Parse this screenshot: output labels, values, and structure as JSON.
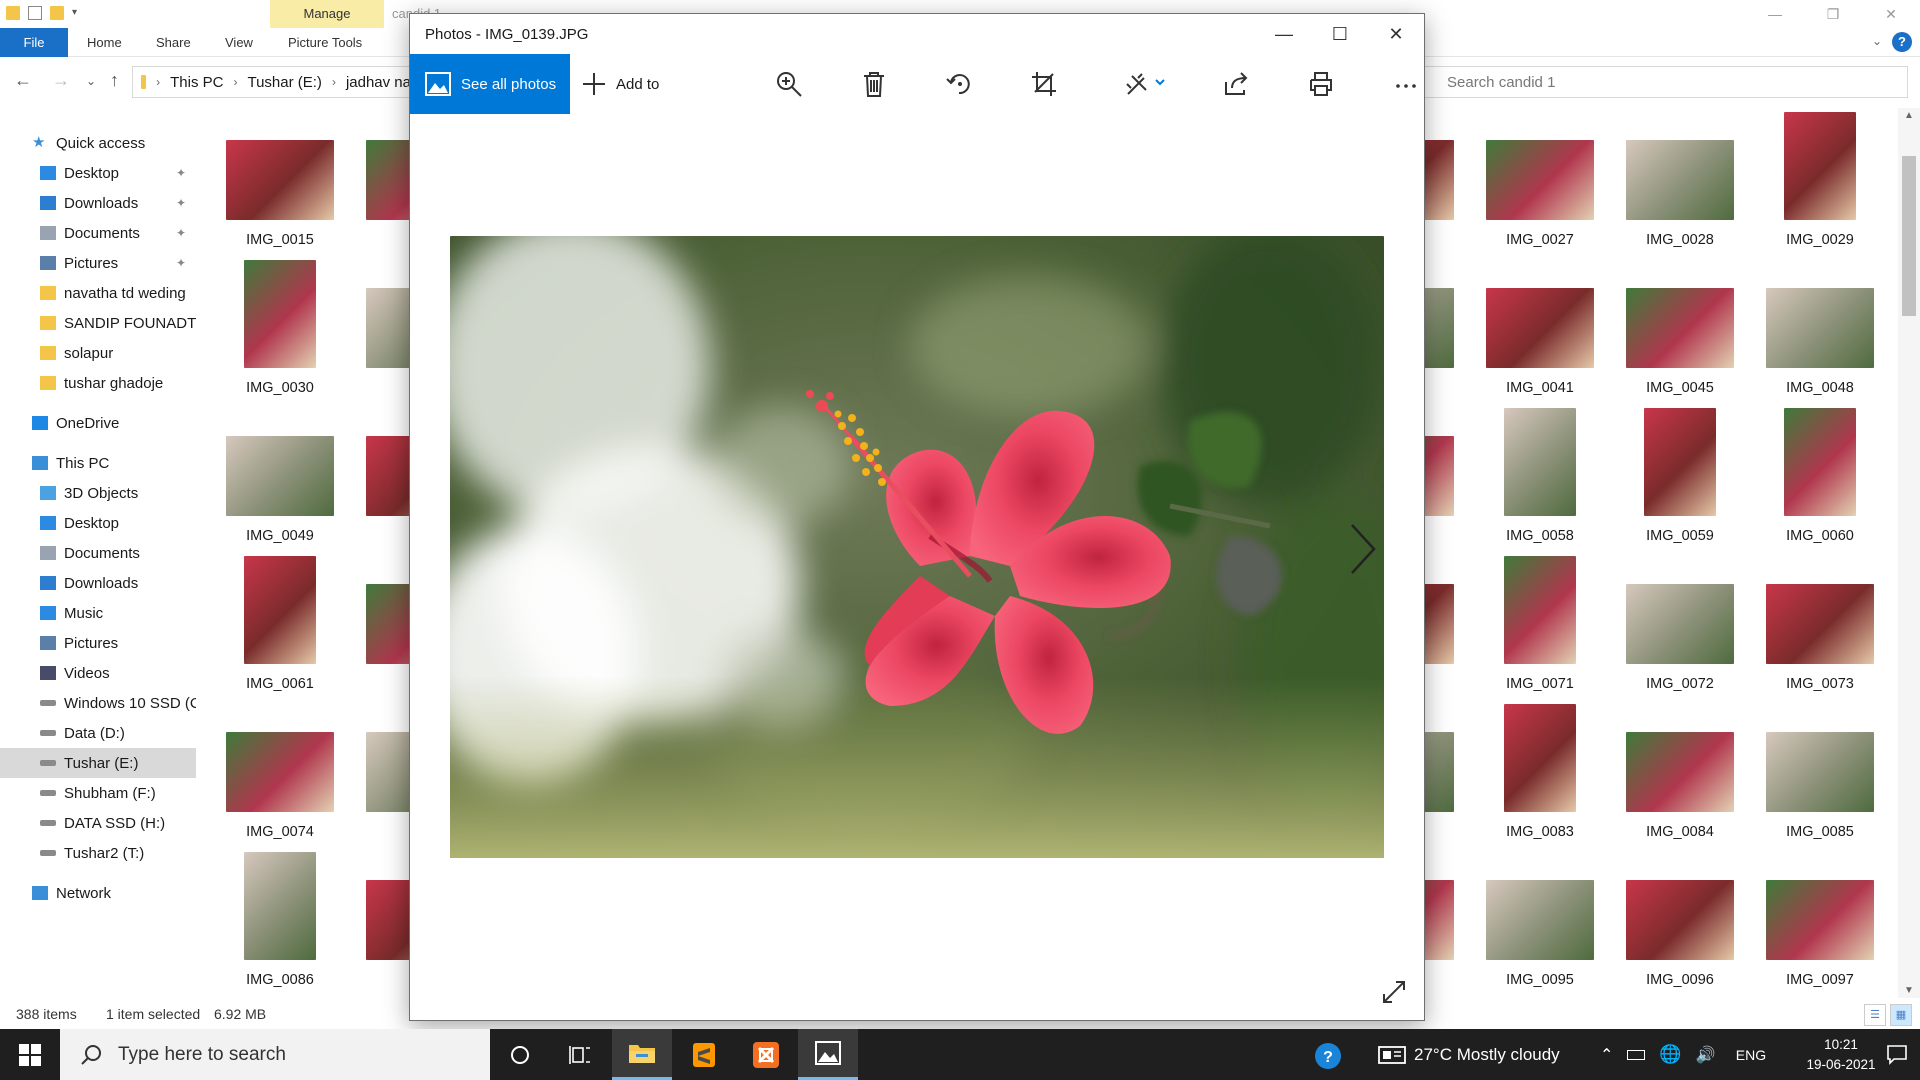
{
  "explorer": {
    "title": "candid 1",
    "ribbon": {
      "manage_label": "Manage",
      "tabs": [
        "File",
        "Home",
        "Share",
        "View",
        "Picture Tools"
      ]
    },
    "address": {
      "crumbs": [
        "This PC",
        "Tushar (E:)",
        "jadhav na"
      ]
    },
    "search_placeholder": "Search candid 1",
    "navpane": [
      {
        "label": "Quick access",
        "icon": "star-icon",
        "indent": 1
      },
      {
        "label": "Desktop",
        "icon": "desktop-icon",
        "indent": 2,
        "pinned": true
      },
      {
        "label": "Downloads",
        "icon": "download-icon",
        "indent": 2,
        "pinned": true
      },
      {
        "label": "Documents",
        "icon": "document-icon",
        "indent": 2,
        "pinned": true
      },
      {
        "label": "Pictures",
        "icon": "pictures-icon",
        "indent": 2,
        "pinned": true
      },
      {
        "label": "navatha td weding",
        "icon": "folder-icon",
        "indent": 2
      },
      {
        "label": "SANDIP FOUNADTI(",
        "icon": "folder-icon",
        "indent": 2
      },
      {
        "label": "solapur",
        "icon": "folder-icon",
        "indent": 2
      },
      {
        "label": "tushar ghadoje",
        "icon": "folder-icon",
        "indent": 2
      },
      {
        "label": "OneDrive",
        "icon": "cloud-icon",
        "indent": 1
      },
      {
        "label": "This PC",
        "icon": "pc-icon",
        "indent": 1
      },
      {
        "label": "3D Objects",
        "icon": "cube-icon",
        "indent": 2
      },
      {
        "label": "Desktop",
        "icon": "desktop-icon",
        "indent": 2
      },
      {
        "label": "Documents",
        "icon": "document-icon",
        "indent": 2
      },
      {
        "label": "Downloads",
        "icon": "download-icon",
        "indent": 2
      },
      {
        "label": "Music",
        "icon": "music-icon",
        "indent": 2
      },
      {
        "label": "Pictures",
        "icon": "pictures-icon",
        "indent": 2
      },
      {
        "label": "Videos",
        "icon": "video-icon",
        "indent": 2
      },
      {
        "label": "Windows 10 SSD (C",
        "icon": "drive-icon",
        "indent": 2
      },
      {
        "label": "Data (D:)",
        "icon": "drive-icon",
        "indent": 2
      },
      {
        "label": "Tushar (E:)",
        "icon": "drive-icon",
        "indent": 2,
        "selected": true
      },
      {
        "label": "Shubham (F:)",
        "icon": "drive-icon",
        "indent": 2
      },
      {
        "label": "DATA SSD (H:)",
        "icon": "drive-icon",
        "indent": 2
      },
      {
        "label": "Tushar2 (T:)",
        "icon": "drive-icon",
        "indent": 2
      },
      {
        "label": "Network",
        "icon": "network-icon",
        "indent": 1
      }
    ],
    "files_left": [
      [
        "IMG_0015",
        "IM"
      ],
      [
        "IMG_0030",
        "IM"
      ],
      [
        "IMG_0049",
        "IM"
      ],
      [
        "IMG_0061",
        "IM"
      ],
      [
        "IMG_0074",
        "IM"
      ],
      [
        "IMG_0086",
        "IM"
      ]
    ],
    "files_right": [
      [
        "26",
        "IMG_0027",
        "IMG_0028",
        "IMG_0029"
      ],
      [
        "39",
        "IMG_0041",
        "IMG_0045",
        "IMG_0048"
      ],
      [
        "57",
        "IMG_0058",
        "IMG_0059",
        "IMG_0060"
      ],
      [
        "70",
        "IMG_0071",
        "IMG_0072",
        "IMG_0073"
      ],
      [
        "82",
        "IMG_0083",
        "IMG_0084",
        "IMG_0085"
      ],
      [
        "94",
        "IMG_0095",
        "IMG_0096",
        "IMG_0097"
      ]
    ],
    "status": {
      "items": "388 items",
      "selected": "1 item selected",
      "size": "6.92 MB"
    }
  },
  "photos": {
    "title": "Photos - IMG_0139.JPG",
    "see_all_label": "See all photos",
    "add_to_label": "Add to",
    "tools": [
      "zoom-in-icon",
      "delete-icon",
      "rotate-icon",
      "crop-icon",
      "edit-icon",
      "share-icon",
      "print-icon",
      "more-icon"
    ],
    "accent": "#0078d7"
  },
  "taskbar": {
    "search_placeholder": "Type here to search",
    "apps": [
      "cortana-icon",
      "task-view-icon",
      "file-explorer-icon",
      "sublime-icon",
      "xampp-icon",
      "photos-icon"
    ],
    "weather": "27°C  Mostly cloudy",
    "language": "ENG",
    "time": "10:21",
    "date": "19-06-2021"
  }
}
